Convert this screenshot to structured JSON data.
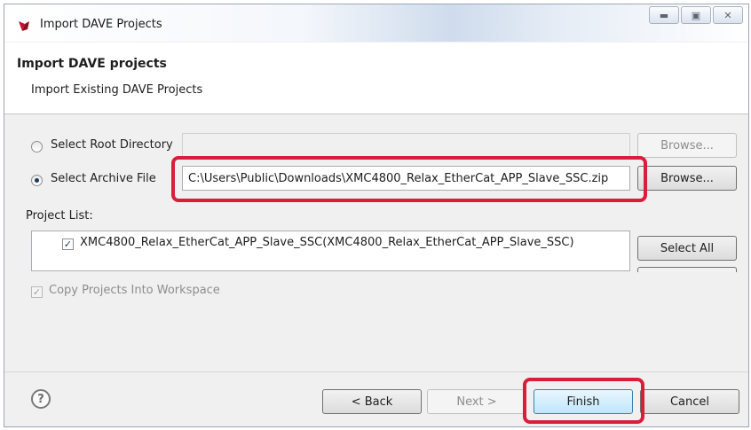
{
  "window": {
    "title": "Import DAVE Projects",
    "controls": [
      "minimize",
      "maximize",
      "close"
    ]
  },
  "header": {
    "title": "Import DAVE projects",
    "subtitle": "Import Existing DAVE Projects"
  },
  "root_directory": {
    "label": "Select Root Directory",
    "value": "",
    "browse_label": "Browse...",
    "selected": false
  },
  "archive_file": {
    "label": "Select Archive File",
    "value": "C:\\Users\\Public\\Downloads\\XMC4800_Relax_EtherCat_APP_Slave_SSC.zip",
    "browse_label": "Browse...",
    "selected": true
  },
  "project_list": {
    "label": "Project List:",
    "items": [
      {
        "label": "XMC4800_Relax_EtherCat_APP_Slave_SSC(XMC4800_Relax_EtherCat_APP_Slave_SSC)",
        "checked": true
      }
    ],
    "select_all_label": "Select All"
  },
  "copy_projects": {
    "label": "Copy Projects Into Workspace",
    "checked": true,
    "enabled": false
  },
  "footer": {
    "back_label": "< Back",
    "next_label": "Next >",
    "finish_label": "Finish",
    "cancel_label": "Cancel"
  },
  "colors": {
    "highlight": "#d81e3a",
    "dialog_bg": "#f0f0f0"
  }
}
